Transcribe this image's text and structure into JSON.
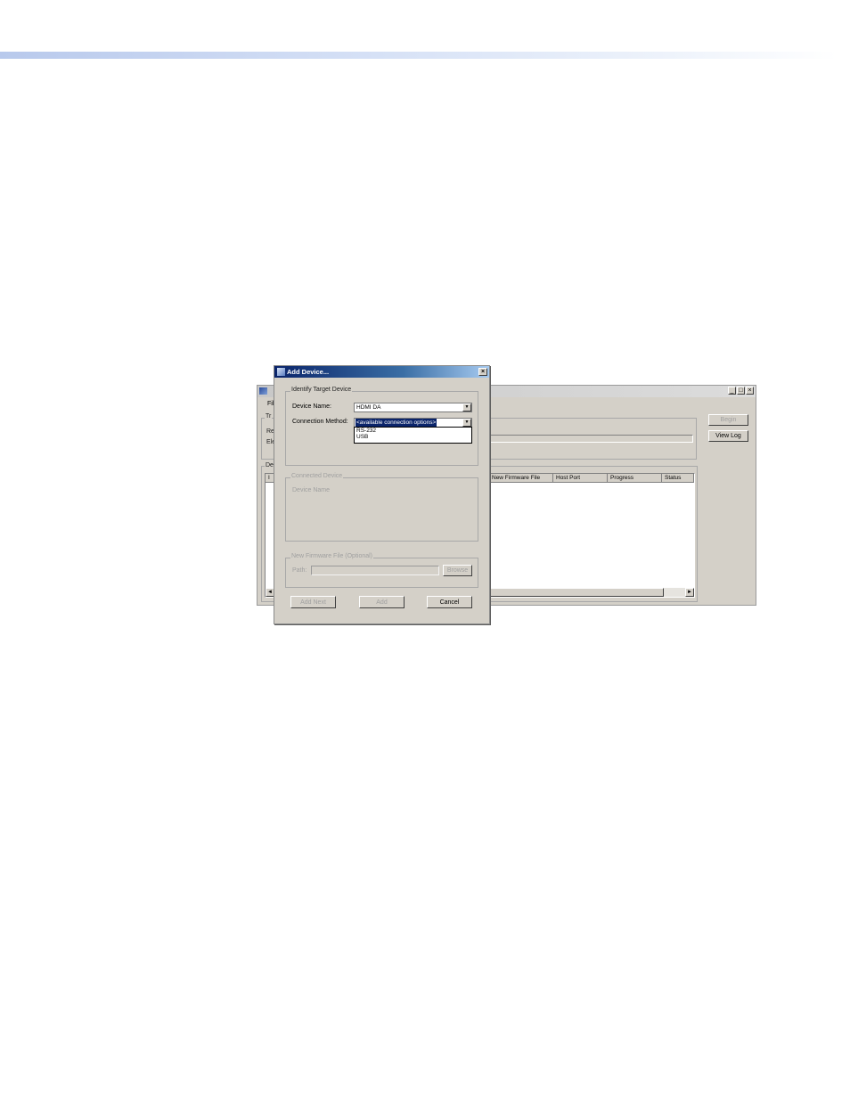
{
  "main_window": {
    "menu_file": "File",
    "group_transfer_label": "Tr",
    "row1_label": "Re",
    "row2_label": "Ele",
    "group_devices_label": "Dev",
    "first_col_label": "I",
    "buttons": {
      "begin": "Begin",
      "view_log": "View Log"
    },
    "window_controls": {
      "minimize": "_",
      "maximize": "□",
      "close": "×"
    },
    "table": {
      "columns": [
        "New Firmware File",
        "Host Port",
        "Progress",
        "Status"
      ]
    },
    "scroll_left": "◄",
    "scroll_right": "►"
  },
  "dialog": {
    "title": "Add Device...",
    "close": "×",
    "identify_group": {
      "label": "Identify Target Device",
      "device_name_label": "Device Name:",
      "device_name_value": "HDMI DA",
      "connection_method_label": "Connection Method:",
      "connection_method_value": "<available connection options>",
      "options": [
        "RS-232",
        "USB"
      ]
    },
    "connected_group": {
      "label": "Connected Device",
      "device_name_label": "Device Name"
    },
    "firmware_group": {
      "label": "New Firmware File (Optional)",
      "path_label": "Path:",
      "path_value": "",
      "browse": "Browse"
    },
    "buttons": {
      "add_next": "Add Next",
      "add": "Add",
      "cancel": "Cancel"
    },
    "dropdown_arrow": "▼"
  }
}
